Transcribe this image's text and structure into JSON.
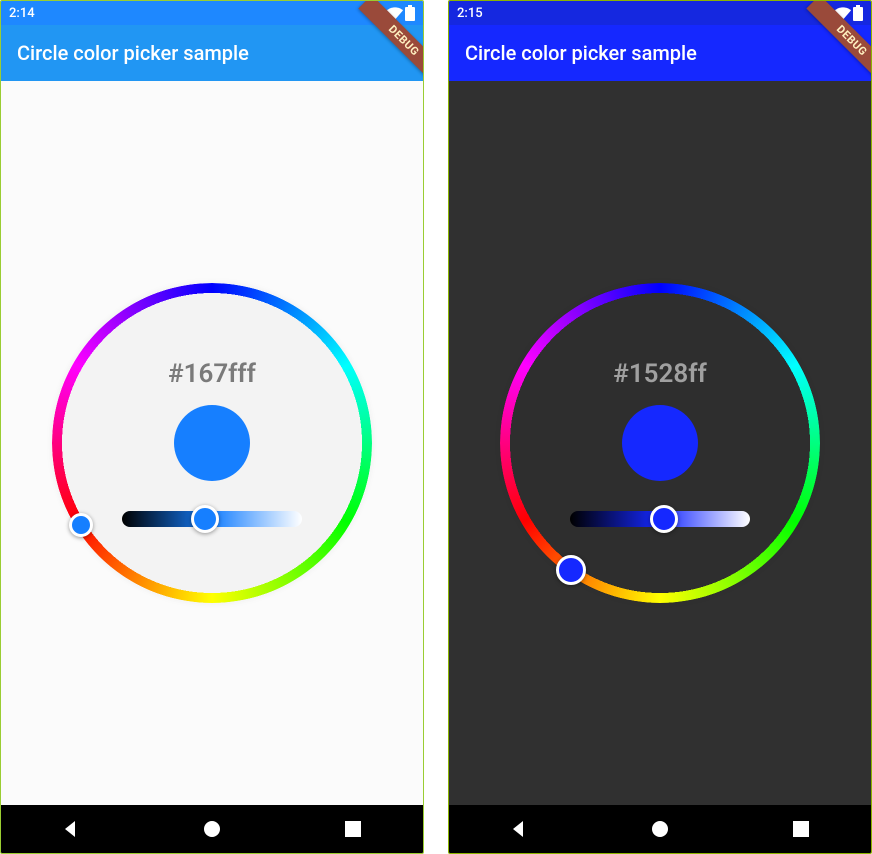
{
  "screens": [
    {
      "status": {
        "time": "2:14",
        "bg": "#1e88ff"
      },
      "appbar": {
        "title": "Circle color picker sample",
        "bg": "#2196f3"
      },
      "body_bg": "#fbfbfb",
      "hex_text": "#167fff",
      "hex_color": "#7a7a7a",
      "selected_color": "#167fff",
      "hue_deg": 212,
      "hue_thumb_size": 24,
      "light_frac": 0.46,
      "slider_gradient_from": "#000000",
      "slider_gradient_mid": "#167fff",
      "slider_gradient_to": "#ffffff",
      "debug_label": "DEBUG"
    },
    {
      "status": {
        "time": "2:15",
        "bg": "#1528e0"
      },
      "appbar": {
        "title": "Circle color picker sample",
        "bg": "#1528ff"
      },
      "body_bg": "#303030",
      "hex_text": "#1528ff",
      "hex_color": "#a0a0a0",
      "selected_color": "#1528ff",
      "hue_deg": 235,
      "hue_thumb_size": 30,
      "light_frac": 0.52,
      "slider_gradient_from": "#000000",
      "slider_gradient_mid": "#1528ff",
      "slider_gradient_to": "#ffffff",
      "debug_label": "DEBUG"
    }
  ],
  "nav": {
    "back": "back-icon",
    "home": "home-icon",
    "recents": "recents-icon"
  }
}
